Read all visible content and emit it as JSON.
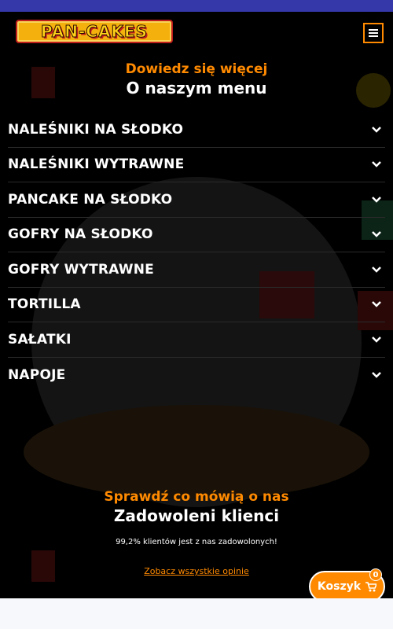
{
  "brand": {
    "logo_text": "PAN-CAKES"
  },
  "menu_section": {
    "kicker": "Dowiedz się więcej",
    "title": "O naszym menu",
    "items": [
      {
        "label": "NALEŚNIKI NA SŁODKO"
      },
      {
        "label": "NALEŚNIKI WYTRAWNE"
      },
      {
        "label": "PANCAKE NA SŁODKO"
      },
      {
        "label": "GOFRY NA SŁODKO"
      },
      {
        "label": "GOFRY WYTRAWNE"
      },
      {
        "label": "TORTILLA"
      },
      {
        "label": "SAŁATKI"
      },
      {
        "label": "NAPOJE"
      }
    ]
  },
  "reviews_section": {
    "kicker": "Sprawdź co mówią o nas",
    "title": "Zadowoleni klienci",
    "text": "99,2% klientów jest z nas zadowolonych!",
    "link_label": "Zobacz wszystkie opinie"
  },
  "cart": {
    "label": "Koszyk",
    "count": "0"
  },
  "colors": {
    "accent": "#ff8a00",
    "topbar": "#3538a8",
    "background": "#000000"
  }
}
